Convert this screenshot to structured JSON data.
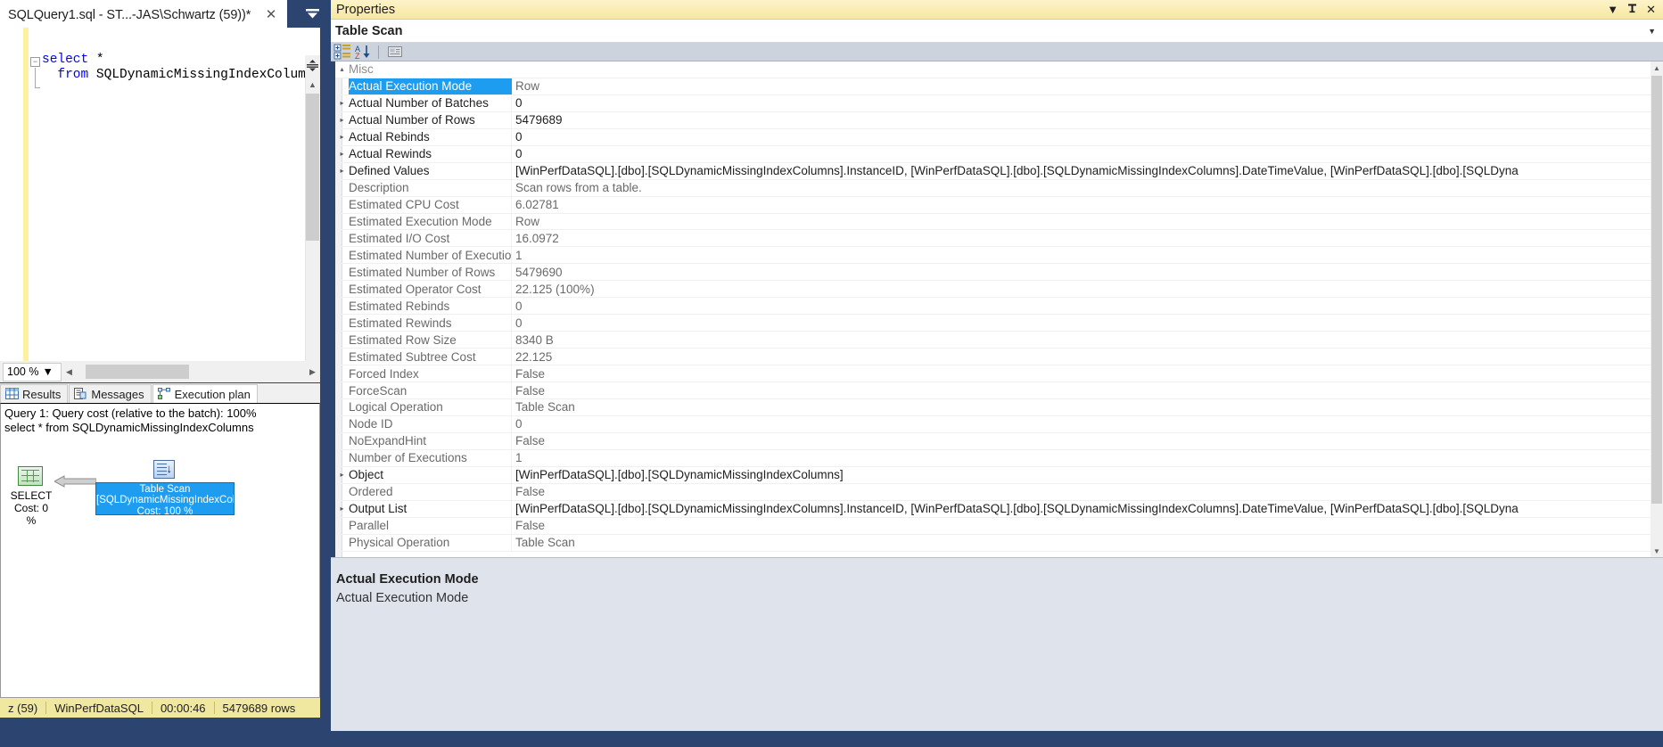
{
  "editor": {
    "tab_label": "SQLQuery1.sql - ST...-JAS\\Schwartz (59))*",
    "close_icon": "close-icon",
    "overflow_icon": "tab-overflow-icon",
    "outline_glyph": "−",
    "code": {
      "line1_keyword": "select",
      "line1_rest": " *",
      "line2_keyword": "  from",
      "line2_rest": " SQLDynamicMissingIndexColumns"
    }
  },
  "zoom_bar": {
    "zoom_value": "100 %",
    "caret_icon": "chevron-down-icon",
    "scroll_left_icon": "chevron-left-icon",
    "scroll_right_icon": "chevron-right-icon"
  },
  "result_tabs": [
    {
      "label": "Results",
      "icon": "grid-icon",
      "active": false
    },
    {
      "label": "Messages",
      "icon": "message-icon",
      "active": false
    },
    {
      "label": "Execution plan",
      "icon": "execution-plan-icon",
      "active": true
    }
  ],
  "plan": {
    "header_line1": "Query 1: Query cost (relative to the batch): 100%",
    "header_line2": "select * from SQLDynamicMissingIndexColumns",
    "nodes": [
      {
        "name": "select-node",
        "icon": "select-operator-icon",
        "label": "SELECT",
        "cost": "Cost: 0 %"
      },
      {
        "name": "table-scan-node",
        "icon": "table-scan-operator-icon",
        "title": "Table Scan",
        "object": "[SQLDynamicMissingIndexColumns]",
        "cost": "Cost: 100 %"
      }
    ],
    "arrow_icon": "data-flow-arrow-icon"
  },
  "query_status": {
    "session": "z (59)",
    "database": "WinPerfDataSQL",
    "elapsed": "00:00:46",
    "rows": "5479689 rows"
  },
  "properties": {
    "window_title": "Properties",
    "window_buttons": [
      {
        "name": "dropdown-menu-button",
        "glyph": "▼"
      },
      {
        "name": "pin-button",
        "glyph": "📌"
      },
      {
        "name": "close-button",
        "glyph": "✕"
      }
    ],
    "object_name": "Table Scan",
    "object_expand_icon": "chevron-down-icon",
    "toolbar": [
      {
        "name": "categorized-button",
        "icon": "categorized-icon"
      },
      {
        "name": "alphabetical-button",
        "icon": "sort-az-icon"
      },
      {
        "name": "property-pages-button",
        "icon": "property-pages-icon"
      }
    ],
    "category": "Misc",
    "category_expander": "▴",
    "rows": [
      {
        "name": "Actual Execution Mode",
        "value": "Row",
        "expandable": false,
        "selected": true
      },
      {
        "name": "Actual Number of Batches",
        "value": "0",
        "expandable": true,
        "bold": true
      },
      {
        "name": "Actual Number of Rows",
        "value": "5479689",
        "expandable": true,
        "bold": true
      },
      {
        "name": "Actual Rebinds",
        "value": "0",
        "expandable": true,
        "bold": true
      },
      {
        "name": "Actual Rewinds",
        "value": "0",
        "expandable": true,
        "bold": true
      },
      {
        "name": "Defined Values",
        "value": "[WinPerfDataSQL].[dbo].[SQLDynamicMissingIndexColumns].InstanceID, [WinPerfDataSQL].[dbo].[SQLDynamicMissingIndexColumns].DateTimeValue, [WinPerfDataSQL].[dbo].[SQLDyna",
        "expandable": true,
        "bold": true
      },
      {
        "name": "Description",
        "value": "Scan rows from a table.",
        "expandable": false
      },
      {
        "name": "Estimated CPU Cost",
        "value": "6.02781",
        "expandable": false
      },
      {
        "name": "Estimated Execution Mode",
        "value": "Row",
        "expandable": false
      },
      {
        "name": "Estimated I/O Cost",
        "value": "16.0972",
        "expandable": false
      },
      {
        "name": "Estimated Number of Executions",
        "value": "1",
        "expandable": false
      },
      {
        "name": "Estimated Number of Rows",
        "value": "5479690",
        "expandable": false
      },
      {
        "name": "Estimated Operator Cost",
        "value": "22.125 (100%)",
        "expandable": false
      },
      {
        "name": "Estimated Rebinds",
        "value": "0",
        "expandable": false
      },
      {
        "name": "Estimated Rewinds",
        "value": "0",
        "expandable": false
      },
      {
        "name": "Estimated Row Size",
        "value": "8340 B",
        "expandable": false
      },
      {
        "name": "Estimated Subtree Cost",
        "value": "22.125",
        "expandable": false
      },
      {
        "name": "Forced Index",
        "value": "False",
        "expandable": false
      },
      {
        "name": "ForceScan",
        "value": "False",
        "expandable": false
      },
      {
        "name": "Logical Operation",
        "value": "Table Scan",
        "expandable": false
      },
      {
        "name": "Node ID",
        "value": "0",
        "expandable": false
      },
      {
        "name": "NoExpandHint",
        "value": "False",
        "expandable": false
      },
      {
        "name": "Number of Executions",
        "value": "1",
        "expandable": false
      },
      {
        "name": "Object",
        "value": "[WinPerfDataSQL].[dbo].[SQLDynamicMissingIndexColumns]",
        "expandable": true,
        "bold": true
      },
      {
        "name": "Ordered",
        "value": "False",
        "expandable": false
      },
      {
        "name": "Output List",
        "value": "[WinPerfDataSQL].[dbo].[SQLDynamicMissingIndexColumns].InstanceID, [WinPerfDataSQL].[dbo].[SQLDynamicMissingIndexColumns].DateTimeValue, [WinPerfDataSQL].[dbo].[SQLDyna",
        "expandable": true,
        "bold": true
      },
      {
        "name": "Parallel",
        "value": "False",
        "expandable": false
      },
      {
        "name": "Physical Operation",
        "value": "Table Scan",
        "expandable": false
      }
    ],
    "description": {
      "title": "Actual Execution Mode",
      "text": "Actual Execution Mode"
    }
  },
  "colors": {
    "accent_blue": "#1e9cf0",
    "title_yellow": "#f8e7a0",
    "status_yellow": "#f0e7a0",
    "shell_navy": "#2c4470",
    "keyword_blue": "#0000ff"
  }
}
